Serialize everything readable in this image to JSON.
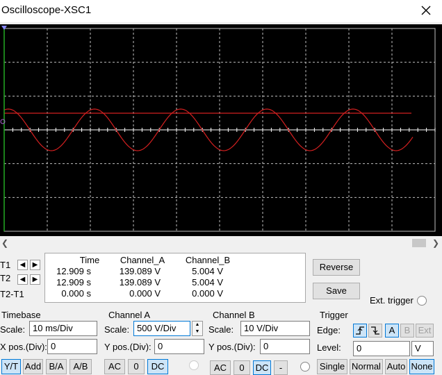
{
  "window": {
    "title": "Oscilloscope-XSC1"
  },
  "colors": {
    "screen": "#000000",
    "grid": "#bfbfbf",
    "trace_a": "#d42020",
    "cursor": "#22aa22"
  },
  "readout": {
    "headers": [
      "Time",
      "Channel_A",
      "Channel_B"
    ],
    "rows": [
      {
        "label": "T1",
        "time": "12.909 s",
        "a": "139.089 V",
        "b": "5.004 V"
      },
      {
        "label": "T2",
        "time": "12.909 s",
        "a": "139.089 V",
        "b": "5.004 V"
      },
      {
        "label": "T2-T1",
        "time": "0.000 s",
        "a": "0.000 V",
        "b": "0.000 V"
      }
    ]
  },
  "buttons": {
    "reverse": "Reverse",
    "save": "Save",
    "ext_trigger": "Ext. trigger"
  },
  "timebase": {
    "title": "Timebase",
    "scale_label": "Scale:",
    "scale": "10 ms/Div",
    "xpos_label": "X pos.(Div):",
    "xpos": "0",
    "modes": [
      "Y/T",
      "Add",
      "B/A",
      "A/B"
    ]
  },
  "channel_a": {
    "title": "Channel A",
    "scale_label": "Scale:",
    "scale": "500  V/Div",
    "ypos_label": "Y pos.(Div):",
    "ypos": "0",
    "coupling": [
      "AC",
      "0",
      "DC"
    ]
  },
  "channel_b": {
    "title": "Channel B",
    "scale_label": "Scale:",
    "scale": "10  V/Div",
    "ypos_label": "Y pos.(Div):",
    "ypos": "0",
    "coupling": [
      "AC",
      "0",
      "DC",
      "-"
    ]
  },
  "trigger": {
    "title": "Trigger",
    "edge_label": "Edge:",
    "level_label": "Level:",
    "level": "0",
    "level_unit": "V",
    "sources": [
      "A",
      "B",
      "Ext"
    ],
    "modes": [
      "Single",
      "Normal",
      "Auto",
      "None"
    ]
  },
  "icons": {
    "close": "close-icon",
    "left": "arrow-left-icon",
    "right": "arrow-right-icon",
    "rising": "rising-edge-icon",
    "falling": "falling-edge-icon"
  }
}
